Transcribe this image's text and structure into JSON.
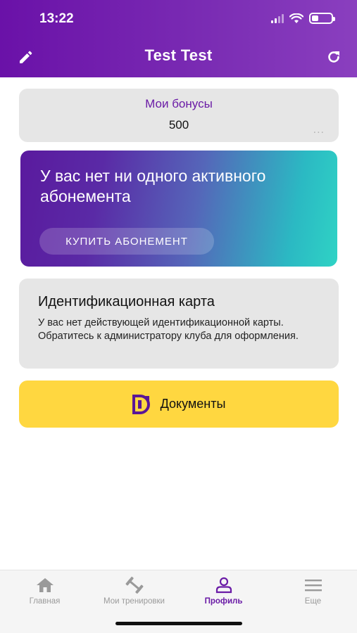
{
  "status_bar": {
    "time": "13:22"
  },
  "header": {
    "title": "Test Test"
  },
  "bonus_card": {
    "title": "Мои бонусы",
    "value": "500",
    "more": "..."
  },
  "subscription_card": {
    "message": "У вас нет ни одного активного абонемента",
    "buy_label": "КУПИТЬ АБОНЕМЕНТ"
  },
  "id_card": {
    "title": "Идентификационная карта",
    "text": "У вас нет действующей идентификационной карты. Обратитесь к администратору клуба для оформления."
  },
  "documents": {
    "label": "Документы"
  },
  "tabbar": {
    "items": [
      {
        "label": "Главная",
        "icon": "home-icon"
      },
      {
        "label": "Мои тренировки",
        "icon": "dumbbell-icon"
      },
      {
        "label": "Профиль",
        "icon": "profile-icon"
      },
      {
        "label": "Еще",
        "icon": "menu-icon"
      }
    ],
    "active": "Профиль"
  },
  "colors": {
    "primary": "#6a1ba6",
    "accent": "#ffd740",
    "teal": "#2fd3c5",
    "card_bg": "#e6e6e6"
  }
}
